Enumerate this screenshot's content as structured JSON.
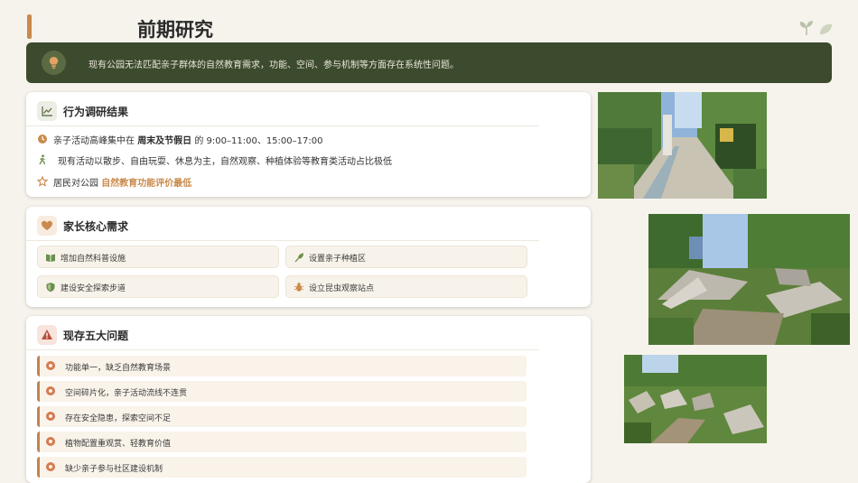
{
  "page": {
    "title": "前期研究"
  },
  "banner": {
    "text": "现有公园无法匹配亲子群体的自然教育需求，功能、空间、参与机制等方面存在系统性问题。",
    "icon": "lightbulb-icon"
  },
  "survey": {
    "title": "行为调研结果",
    "icon": "chart-line-icon",
    "rows": [
      {
        "icon": "clock-icon",
        "prefix": "亲子活动高峰集中在 ",
        "bold": "周末及节假日",
        "suffix": " 的 9:00–11:00、15:00–17:00"
      },
      {
        "icon": "walking-icon",
        "text": "现有活动以散步、自由玩耍、休息为主，自然观察、种植体验等教育类活动占比极低"
      },
      {
        "icon": "star-icon",
        "prefix": "居民对公园 ",
        "accent": "自然教育功能评价最低"
      }
    ]
  },
  "needs": {
    "title": "家长核心需求",
    "icon": "heart-icon",
    "items": [
      {
        "label": "增加自然科普设施",
        "icon": "book-icon"
      },
      {
        "label": "设置亲子种植区",
        "icon": "seedling-icon"
      },
      {
        "label": "建设安全探索步道",
        "icon": "shield-icon"
      },
      {
        "label": "设立昆虫观察站点",
        "icon": "bug-icon"
      }
    ]
  },
  "issues": {
    "title": "现存五大问题",
    "icon": "warning-icon",
    "items": [
      "功能单一，缺乏自然教育场景",
      "空间碎片化，亲子活动流线不连贯",
      "存在安全隐患，探索空间不足",
      "植物配置重观赏、轻教育价值",
      "缺少亲子参与社区建设机制"
    ]
  },
  "colors": {
    "accent": "#c98a4b",
    "banner_bg": "#3c4a2d",
    "page_bg": "#f6f3ec",
    "issue_border": "#c28350"
  }
}
